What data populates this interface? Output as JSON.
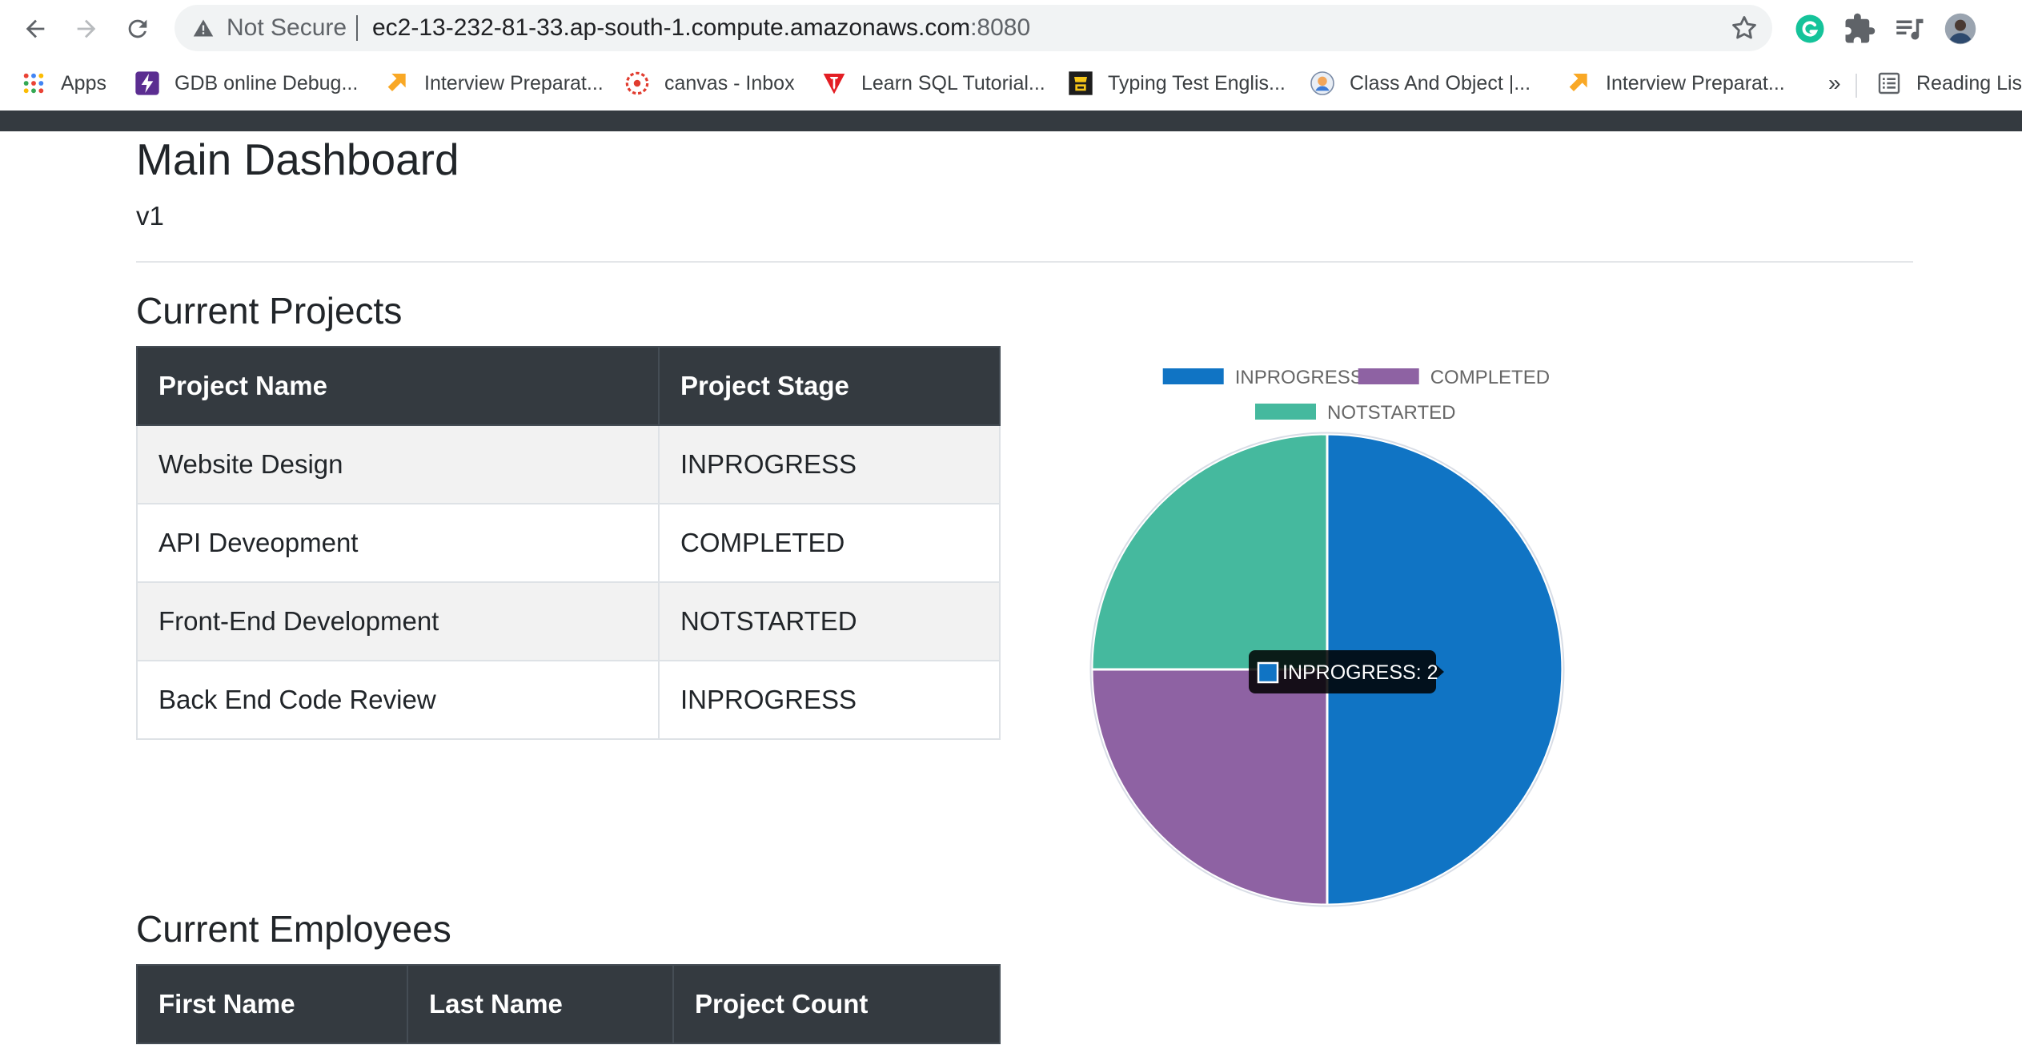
{
  "browser": {
    "security_label": "Not Secure",
    "url_host": "ec2-13-232-81-33.ap-south-1.compute.amazonaws.com",
    "url_port": ":8080"
  },
  "bookmarks": {
    "items": [
      {
        "label": "Apps",
        "icon": "apps-grid-icon"
      },
      {
        "label": "GDB online Debug...",
        "icon": "gdb-icon"
      },
      {
        "label": "Interview Preparat...",
        "icon": "arrow-bookmark-icon"
      },
      {
        "label": "canvas - Inbox",
        "icon": "canvas-icon"
      },
      {
        "label": "Learn SQL Tutorial...",
        "icon": "sql-tutorial-icon"
      },
      {
        "label": "Typing Test Englis...",
        "icon": "typing-test-icon"
      },
      {
        "label": "Class And Object |...",
        "icon": "class-object-icon"
      },
      {
        "label": "Interview Preparat...",
        "icon": "arrow-bookmark-icon"
      }
    ],
    "overflow_label": "»",
    "reading_list_label": "Reading List"
  },
  "page": {
    "title": "Main Dashboard",
    "version": "v1"
  },
  "projects": {
    "heading": "Current Projects",
    "columns": [
      "Project Name",
      "Project Stage"
    ],
    "rows": [
      [
        "Website Design",
        "INPROGRESS"
      ],
      [
        "API Deveopment",
        "COMPLETED"
      ],
      [
        "Front-End Development",
        "NOTSTARTED"
      ],
      [
        "Back End Code Review",
        "INPROGRESS"
      ]
    ]
  },
  "employees": {
    "heading": "Current Employees",
    "columns": [
      "First Name",
      "Last Name",
      "Project Count"
    ]
  },
  "chart_data": {
    "type": "pie",
    "categories": [
      "INPROGRESS",
      "COMPLETED",
      "NOTSTARTED"
    ],
    "values": [
      2,
      1,
      1
    ],
    "colors": [
      "#1074c4",
      "#8e62a3",
      "#45b99e"
    ],
    "legend_position": "top",
    "tooltip": "INPROGRESS: 2"
  }
}
